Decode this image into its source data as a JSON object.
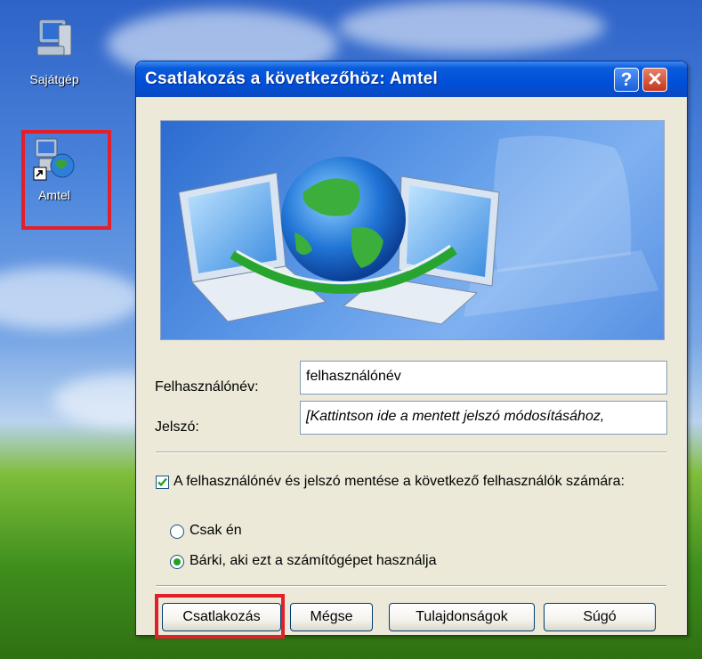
{
  "desktop": {
    "icons": [
      {
        "label": "Sajátgép"
      },
      {
        "label": "Amtel"
      }
    ]
  },
  "dialog": {
    "title": "Csatlakozás a következőhöz: Amtel",
    "username_label": "Felhasználónév:",
    "username_value": "felhasználónév",
    "password_label": "Jelszó:",
    "password_value": "[Kattintson ide a mentett jelszó módosításához,",
    "save_checkbox_label": "A felhasználónév és jelszó mentése a következő felhasználók számára:",
    "save_checked": true,
    "radio_options": [
      {
        "label": "Csak én",
        "selected": false
      },
      {
        "label": "Bárki, aki ezt a számítógépet használja",
        "selected": true
      }
    ],
    "buttons": {
      "connect": "Csatlakozás",
      "cancel": "Mégse",
      "properties": "Tulajdonságok",
      "help": "Súgó"
    }
  },
  "colors": {
    "highlight": "#e0202a",
    "titlebar": "#0050d8",
    "dialog_bg": "#ece9d8"
  }
}
